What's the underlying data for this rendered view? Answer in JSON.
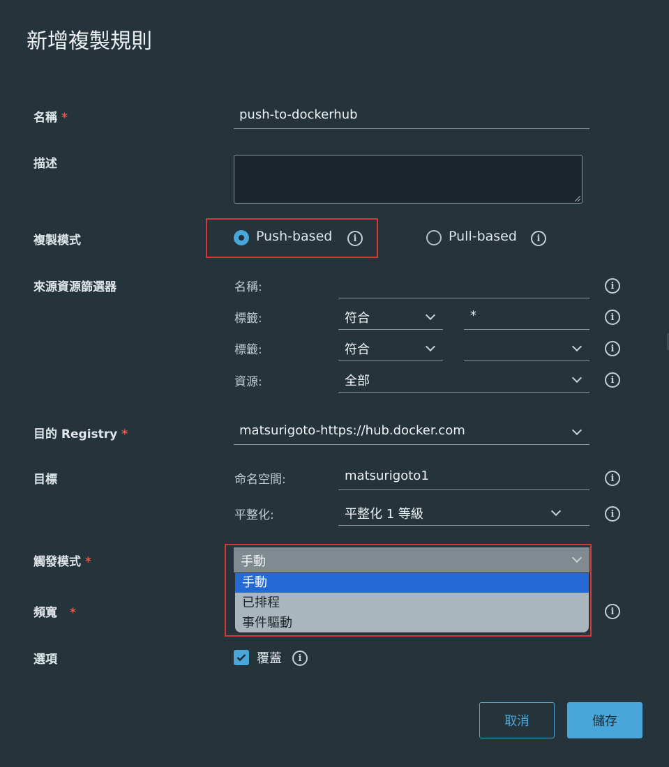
{
  "dialog": {
    "title": "新增複製規則"
  },
  "fields": {
    "name": {
      "label": "名稱",
      "required_mark": "*",
      "value": "push-to-dockerhub"
    },
    "description": {
      "label": "描述",
      "value": ""
    },
    "replication_mode": {
      "label": "複製模式",
      "options": [
        {
          "label": "Push-based",
          "selected": true
        },
        {
          "label": "Pull-based",
          "selected": false
        }
      ]
    },
    "source_filter": {
      "label": "來源資源篩選器",
      "name_label": "名稱:",
      "name_value": "",
      "tag_label": "標籤:",
      "tag_match": "符合",
      "tag_value": "*",
      "label_label": "標籤:",
      "label_match": "符合",
      "label_value": "",
      "resource_label": "資源:",
      "resource_value": "全部"
    },
    "destination_registry": {
      "label": "目的 Registry",
      "required_mark": "*",
      "value": "matsurigoto-https://hub.docker.com"
    },
    "destination": {
      "label": "目標",
      "namespace_label": "命名空間:",
      "namespace_value": "matsurigoto1",
      "flatten_label": "平整化:",
      "flatten_value": "平整化 1 等級"
    },
    "trigger_mode": {
      "label": "觸發模式",
      "required_mark": "*",
      "value": "手動",
      "options": [
        "手動",
        "已排程",
        "事件驅動"
      ],
      "selected_index": 0
    },
    "bandwidth": {
      "label": "頻寬",
      "required_mark": "*"
    },
    "options": {
      "label": "選項",
      "override_label": "覆蓋",
      "override_checked": true
    }
  },
  "footer": {
    "cancel_label": "取消",
    "save_label": "儲存"
  },
  "colors": {
    "accent": "#4aa6d9",
    "highlight_border": "#d93636",
    "selected_option": "#2469d4",
    "background": "#25333b"
  }
}
